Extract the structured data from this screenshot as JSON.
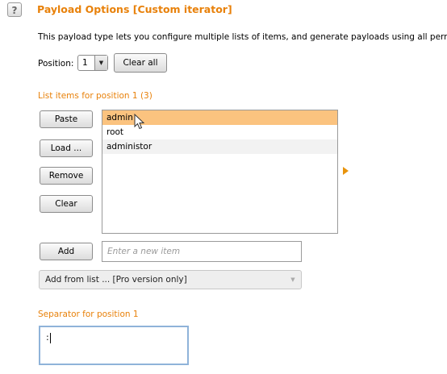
{
  "header": {
    "help_glyph": "?",
    "title": "Payload Options [Custom iterator]",
    "description": "This payload type lets you configure multiple lists of items, and generate payloads using all permuta"
  },
  "position": {
    "label": "Position:",
    "selected": "1",
    "clear_all_label": "Clear all"
  },
  "list_section": {
    "label": "List items for position 1 (3)",
    "items": [
      {
        "text": "admin",
        "selected": true
      },
      {
        "text": "root",
        "selected": false
      },
      {
        "text": "administor",
        "selected": false
      }
    ],
    "buttons": {
      "paste": "Paste",
      "load": "Load ...",
      "remove": "Remove",
      "clear": "Clear",
      "add": "Add"
    },
    "new_item_placeholder": "Enter a new item",
    "add_from_list": "Add from list ... [Pro version only]"
  },
  "separator": {
    "label": "Separator for position 1",
    "value": ":"
  },
  "colors": {
    "accent": "#e8810a",
    "selection": "#fbc37f",
    "focus_border": "#8fb3d9"
  }
}
